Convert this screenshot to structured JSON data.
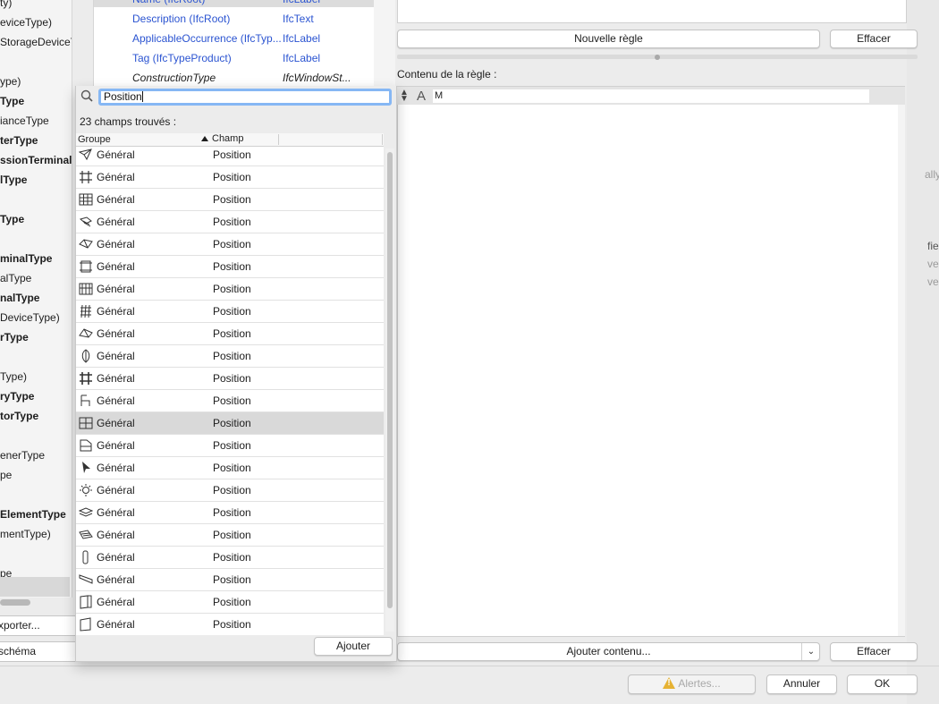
{
  "left_panel": {
    "items": [
      {
        "text": "ty)",
        "bold": false
      },
      {
        "text": "eviceType)",
        "bold": false
      },
      {
        "text": "StorageDeviceT",
        "bold": false
      },
      {
        "text": "",
        "bold": false
      },
      {
        "text": "ype)",
        "bold": false
      },
      {
        "text": "Type",
        "bold": true
      },
      {
        "text": "ianceType",
        "bold": false
      },
      {
        "text": "terType",
        "bold": true
      },
      {
        "text": "ssionTerminalT",
        "bold": true
      },
      {
        "text": "lType",
        "bold": true
      },
      {
        "text": "",
        "bold": false
      },
      {
        "text": "Type",
        "bold": true
      },
      {
        "text": "",
        "bold": false
      },
      {
        "text": "minalType",
        "bold": true
      },
      {
        "text": "alType",
        "bold": false
      },
      {
        "text": "nalType",
        "bold": true
      },
      {
        "text": "DeviceType)",
        "bold": false
      },
      {
        "text": "rType",
        "bold": true
      },
      {
        "text": "",
        "bold": false
      },
      {
        "text": "Type)",
        "bold": false
      },
      {
        "text": "ryType",
        "bold": true
      },
      {
        "text": "torType",
        "bold": true
      },
      {
        "text": "",
        "bold": false
      },
      {
        "text": "enerType",
        "bold": false
      },
      {
        "text": "pe",
        "bold": false
      },
      {
        "text": "",
        "bold": false
      },
      {
        "text": "ElementType",
        "bold": true
      },
      {
        "text": "mentType)",
        "bold": false
      },
      {
        "text": "",
        "bold": false
      },
      {
        "text": "pe",
        "bold": false
      }
    ],
    "export_button": "xporter...",
    "schema_button": "schéma"
  },
  "properties": {
    "rows": [
      {
        "name": "Name (IfcRoot)",
        "type": "IfcLabel",
        "italic": false
      },
      {
        "name": "Description (IfcRoot)",
        "type": "IfcText",
        "italic": false
      },
      {
        "name": "ApplicableOccurrence (IfcTyp...",
        "type": "IfcLabel",
        "italic": false
      },
      {
        "name": "Tag (IfcTypeProduct)",
        "type": "IfcLabel",
        "italic": false
      },
      {
        "name": "ConstructionType",
        "type": "IfcWindowSt...",
        "italic": true
      }
    ]
  },
  "search": {
    "value": "Position",
    "found_text": "23 champs trouvés :",
    "columns": {
      "group": "Groupe",
      "field": "Champ"
    },
    "rows": [
      {
        "icon": "shell-icon",
        "group": "Général",
        "field": "Position"
      },
      {
        "icon": "grid-icon",
        "group": "Général",
        "field": "Position"
      },
      {
        "icon": "curtain-wall-icon",
        "group": "Général",
        "field": "Position"
      },
      {
        "icon": "stair-icon",
        "group": "Général",
        "field": "Position"
      },
      {
        "icon": "roof-icon",
        "group": "Général",
        "field": "Position"
      },
      {
        "icon": "slab-icon",
        "group": "Général",
        "field": "Position"
      },
      {
        "icon": "facade-icon",
        "group": "Général",
        "field": "Position"
      },
      {
        "icon": "mesh-icon",
        "group": "Général",
        "field": "Position"
      },
      {
        "icon": "skylight-icon",
        "group": "Général",
        "field": "Position"
      },
      {
        "icon": "dome-icon",
        "group": "Général",
        "field": "Position"
      },
      {
        "icon": "column-grid-icon",
        "group": "Général",
        "field": "Position"
      },
      {
        "icon": "furniture-icon",
        "group": "Général",
        "field": "Position"
      },
      {
        "icon": "window-icon",
        "group": "Général",
        "field": "Position"
      },
      {
        "icon": "object-icon",
        "group": "Général",
        "field": "Position"
      },
      {
        "icon": "cursor-icon",
        "group": "Général",
        "field": "Position"
      },
      {
        "icon": "lamp-icon",
        "group": "Général",
        "field": "Position"
      },
      {
        "icon": "layer-icon",
        "group": "Général",
        "field": "Position"
      },
      {
        "icon": "ramp-icon",
        "group": "Général",
        "field": "Position"
      },
      {
        "icon": "column-icon",
        "group": "Général",
        "field": "Position"
      },
      {
        "icon": "beam-icon",
        "group": "Général",
        "field": "Position"
      },
      {
        "icon": "door-icon",
        "group": "Général",
        "field": "Position"
      },
      {
        "icon": "wall-icon",
        "group": "Général",
        "field": "Position"
      }
    ],
    "selected_index": 12,
    "add_button": "Ajouter"
  },
  "rule_panel": {
    "new_rule_button": "Nouvelle règle",
    "clear_button": "Effacer",
    "content_label": "Contenu de la règle :",
    "content_value": "M",
    "add_content_button": "Ajouter contenu...",
    "clear_content_button": "Effacer"
  },
  "background_right": {
    "t1": "ally",
    "t2": "fie",
    "t3": "ve",
    "t4": "ve"
  },
  "footer": {
    "alerts_button": "Alertes...",
    "cancel_button": "Annuler",
    "ok_button": "OK"
  }
}
